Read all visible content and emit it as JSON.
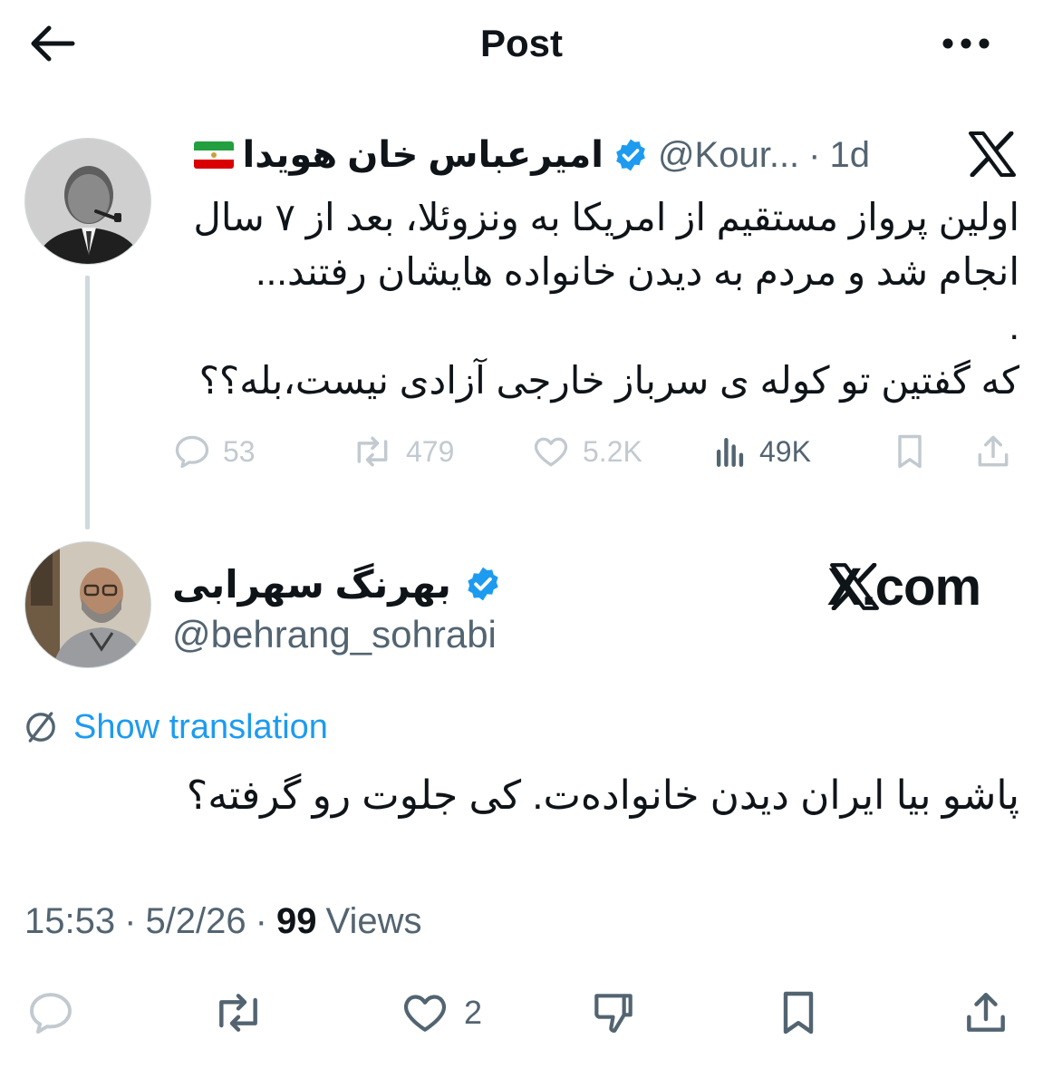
{
  "header": {
    "title": "Post"
  },
  "parent_tweet": {
    "author_name": "امیرعباس خان هویدا",
    "handle": "@Kour...",
    "time": "1d",
    "text_lines": [
      "اولین پرواز مستقیم از امریکا به ونزوئلا، بعد از ۷ سال",
      "انجام شد و مردم به دیدن خانواده هایشان رفتند...",
      ".",
      "که گفتین تو کوله ی سرباز خارجی آزادی نیست،بله؟؟"
    ],
    "stats": {
      "replies": "53",
      "reposts": "479",
      "likes": "5.2K",
      "views": "49K"
    }
  },
  "reply": {
    "author_name": "بهرنگ سهرابی",
    "handle": "@behrang_sohrabi",
    "watermark": "X.com",
    "translate_label": "Show translation",
    "text": "پاشو بیا ایران دیدن خانواده‌ت. کی جلوت رو گرفته؟",
    "time": "15:53",
    "date": "5/2/26",
    "views_count": "99",
    "views_label": "Views",
    "likes": "2"
  },
  "colors": {
    "accent": "#1d9bf0",
    "text": "#0f1419",
    "muted": "#536471",
    "faint": "#c2cad0"
  },
  "icons": [
    "back-arrow-icon",
    "more-icon",
    "verified-icon",
    "x-logo-icon",
    "reply-icon",
    "repost-icon",
    "like-icon",
    "views-icon",
    "bookmark-icon",
    "share-icon",
    "translate-icon",
    "dislike-icon"
  ]
}
